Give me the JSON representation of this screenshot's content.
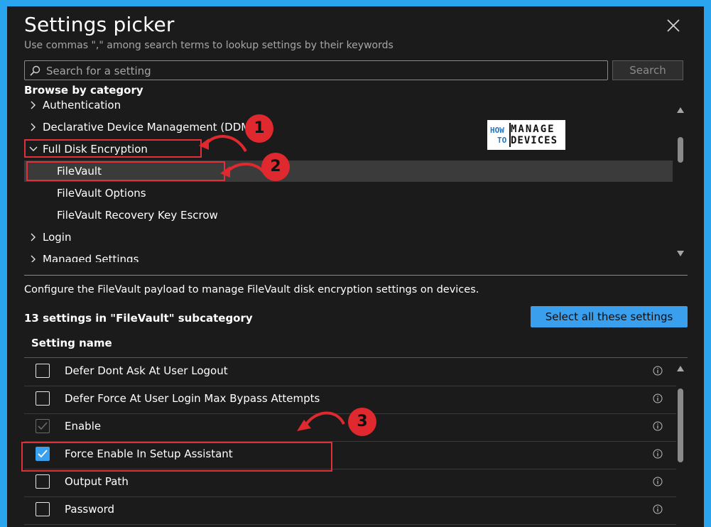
{
  "dialog": {
    "title": "Settings picker",
    "subtitle": "Use commas \",\" among search terms to lookup settings by their keywords"
  },
  "search": {
    "placeholder": "Search for a setting",
    "value": "",
    "button_label": "Search"
  },
  "browse": {
    "heading": "Browse by category",
    "items": [
      {
        "label": "Authentication",
        "expanded": false,
        "level": 0
      },
      {
        "label": "Declarative Device Management (DDM)",
        "expanded": false,
        "level": 0
      },
      {
        "label": "Full Disk Encryption",
        "expanded": true,
        "level": 0
      },
      {
        "label": "FileVault",
        "level": 1,
        "selected": true
      },
      {
        "label": "FileVault Options",
        "level": 1
      },
      {
        "label": "FileVault Recovery Key Escrow",
        "level": 1
      },
      {
        "label": "Login",
        "expanded": false,
        "level": 0
      },
      {
        "label": "Managed Settings",
        "expanded": false,
        "level": 0
      }
    ]
  },
  "details": {
    "description": "Configure the FileVault payload to manage FileVault disk encryption settings on devices.",
    "count_label": "13 settings in \"FileVault\" subcategory",
    "select_all_label": "Select all these settings",
    "column_header": "Setting name",
    "settings": [
      {
        "name": "Defer Dont Ask At User Logout",
        "state": "unchecked"
      },
      {
        "name": "Defer Force At User Login Max Bypass Attempts",
        "state": "unchecked"
      },
      {
        "name": "Enable",
        "state": "checked-disabled"
      },
      {
        "name": "Force Enable In Setup Assistant",
        "state": "checked"
      },
      {
        "name": "Output Path",
        "state": "unchecked"
      },
      {
        "name": "Password",
        "state": "unchecked"
      }
    ]
  },
  "watermark": {
    "line1_left": "HOW",
    "line2_left": "TO",
    "line1_right": "MANAGE",
    "line2_right": "DEVICES"
  },
  "annotations": {
    "step1": "1",
    "step2": "2",
    "step3": "3",
    "color": "#e0282f"
  },
  "colors": {
    "accent": "#3aa0ee",
    "frame": "#2aa4ee",
    "panel_bg": "#1b1b1b"
  }
}
